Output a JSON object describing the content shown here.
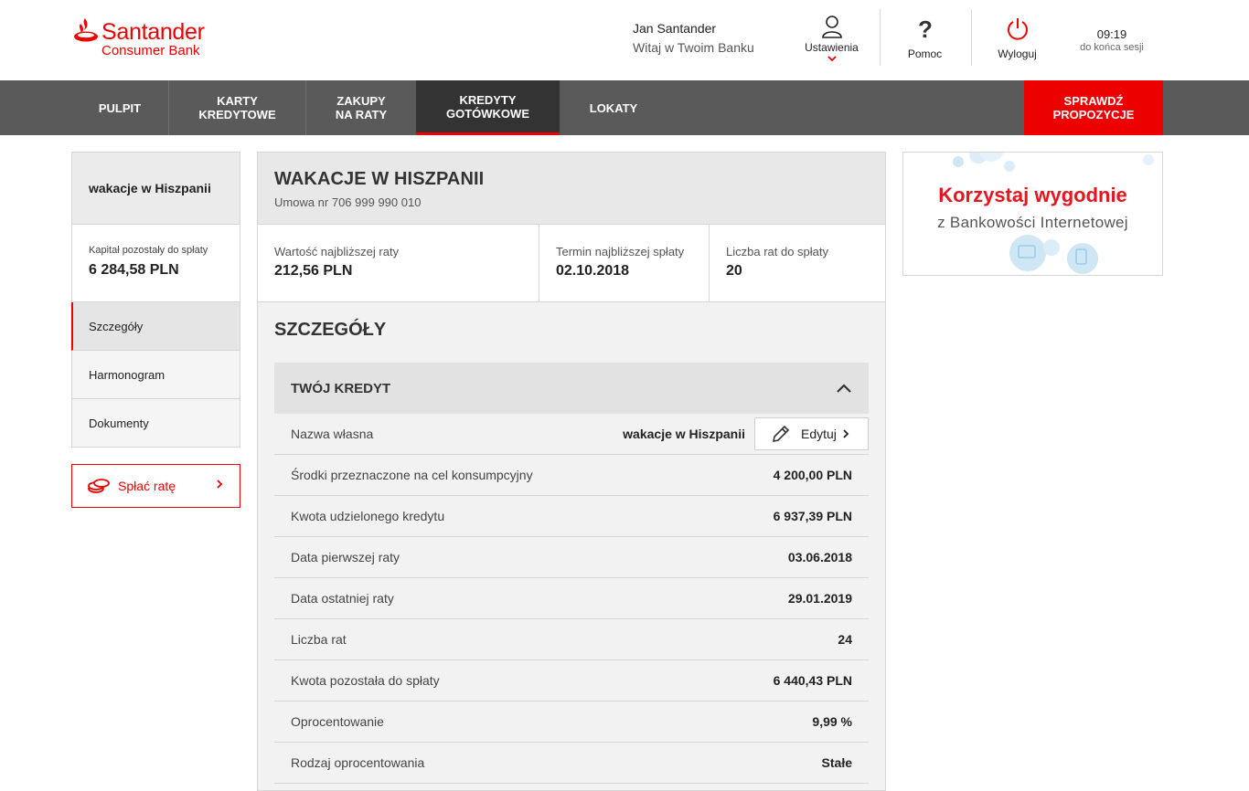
{
  "brand": {
    "name": "Santander",
    "sub": "Consumer Bank"
  },
  "user": {
    "name": "Jan Santander",
    "welcome": "Witaj w Twoim Banku"
  },
  "header": {
    "settings_label": "Ustawienia",
    "help_label": "Pomoc",
    "logout_label": "Wyloguj",
    "session_time": "09:19",
    "session_label": "do końca sesji"
  },
  "nav": {
    "items": [
      {
        "label": "PULPIT"
      },
      {
        "label": "KARTY\nKREDYTOWE"
      },
      {
        "label": "ZAKUPY\nNA RATY"
      },
      {
        "label": "KREDYTY\nGOTÓWKOWE"
      },
      {
        "label": "LOKATY"
      }
    ],
    "active": "KREDYTY GOTÓWKOWE",
    "cta_label": "SPRAWDŹ\nPROPOZYCJE"
  },
  "sidebar": {
    "title": "wakacje w Hiszpanii",
    "capital_label": "Kapitał pozostały do spłaty",
    "capital_value": "6 284,58 PLN",
    "items": [
      {
        "label": "Szczegóły"
      },
      {
        "label": "Harmonogram"
      },
      {
        "label": "Dokumenty"
      }
    ],
    "pay_label": "Spłać ratę"
  },
  "main": {
    "title": "WAKACJE W HISZPANII",
    "contract": "Umowa nr 706 999 990 010",
    "stats": [
      {
        "label": "Wartość najbliższej raty",
        "value": "212,56 PLN"
      },
      {
        "label": "Termin najbliższej spłaty",
        "value": "02.10.2018"
      },
      {
        "label": "Liczba rat do spłaty",
        "value": "20"
      }
    ],
    "section_title": "SZCZEGÓŁY",
    "accordion_title": "TWÓJ KREDYT",
    "edit_label": "Edytuj",
    "rows": [
      {
        "label": "Nazwa własna",
        "value": "wakacje w Hiszpanii"
      },
      {
        "label": "Środki przeznaczone na cel konsumpcyjny",
        "value": "4 200,00 PLN"
      },
      {
        "label": "Kwota udzielonego kredytu",
        "value": "6 937,39 PLN"
      },
      {
        "label": "Data pierwszej raty",
        "value": "03.06.2018"
      },
      {
        "label": "Data ostatniej raty",
        "value": "29.01.2019"
      },
      {
        "label": "Liczba rat",
        "value": "24"
      },
      {
        "label": "Kwota pozostała do spłaty",
        "value": "6 440,43 PLN"
      },
      {
        "label": "Oprocentowanie",
        "value": "9,99 %"
      },
      {
        "label": "Rodzaj oprocentowania",
        "value": "Stałe"
      }
    ]
  },
  "ad": {
    "title": "Korzystaj wygodnie",
    "subtitle": "z Bankowości Internetowej"
  },
  "colors": {
    "brand_red": "#ec0000",
    "nav_bg": "#5a5a5a",
    "nav_active": "#333333"
  }
}
